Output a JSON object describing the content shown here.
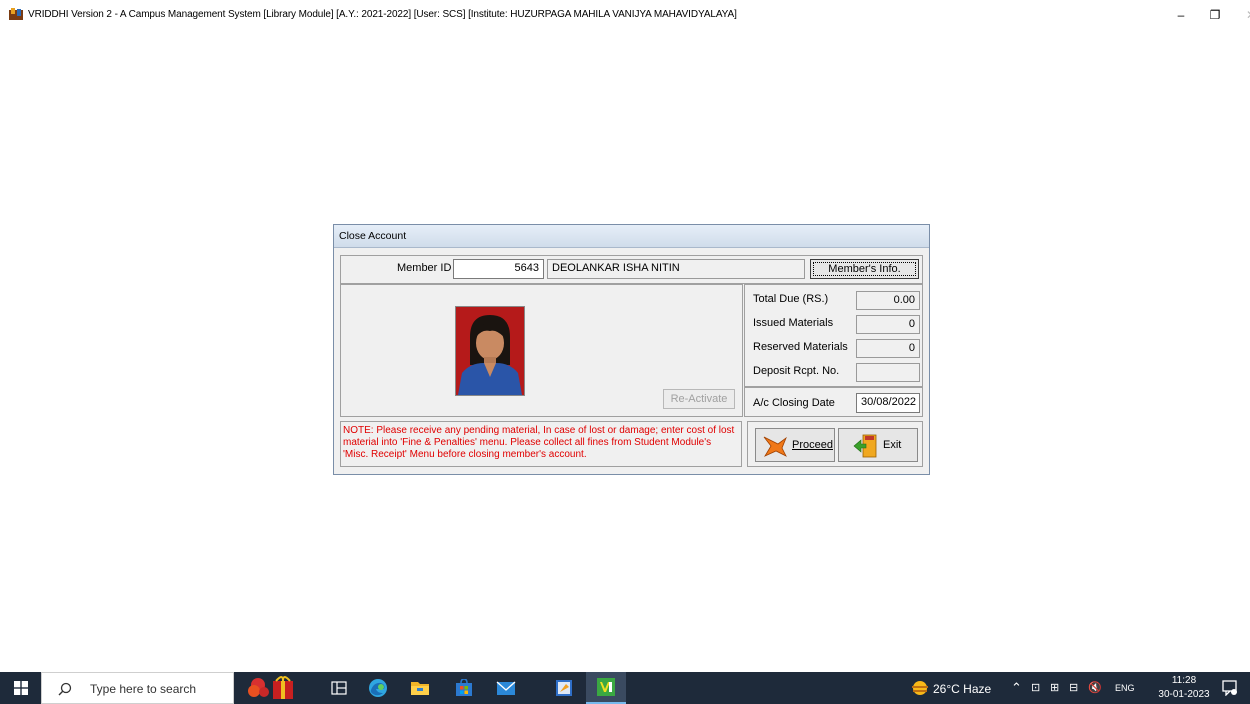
{
  "window": {
    "title": "VRIDDHI Version 2 - A Campus Management System [Library Module] [A.Y.: 2021-2022] [User: SCS] [Institute: HUZURPAGA MAHILA VANIJYA MAHAVIDYALAYA]",
    "minimize": "–",
    "maximize": "❐",
    "close": "✕"
  },
  "dialog": {
    "title": "Close Account",
    "member_id_label": "Member ID",
    "member_id": "5643",
    "member_name": "DEOLANKAR ISHA NITIN",
    "members_info_button": "Member's Info.",
    "reactivate_button": "Re-Activate",
    "total_due_label": "Total Due (RS.)",
    "total_due": "0.00",
    "issued_label": "Issued Materials",
    "issued": "0",
    "reserved_label": "Reserved Materials",
    "reserved": "0",
    "deposit_label": "Deposit Rcpt. No.",
    "deposit": "",
    "closing_date_label": "A/c Closing Date",
    "closing_date": "30/08/2022",
    "note": "NOTE: Please receive any pending material, In case of lost or damage; enter cost of lost material into 'Fine & Penalties' menu. Please collect all fines from Student Module's 'Misc. Receipt' Menu before closing member's account.",
    "proceed_button": "Proceed",
    "exit_button": "Exit"
  },
  "taskbar": {
    "search_placeholder": "Type here to search",
    "weather": "26°C  Haze",
    "language": "ENG",
    "time": "11:28",
    "date": "30-01-2023",
    "icons": [
      "windows-start-icon",
      "search-icon",
      "widgets-icon",
      "task-view-icon",
      "edge-icon",
      "file-explorer-icon",
      "store-icon",
      "mail-icon",
      "app-icon",
      "vriddhi-icon"
    ]
  },
  "colors": {
    "note_text": "#e00000",
    "taskbar": "#1e2a3a",
    "photo_bg": "#b51a1a"
  }
}
